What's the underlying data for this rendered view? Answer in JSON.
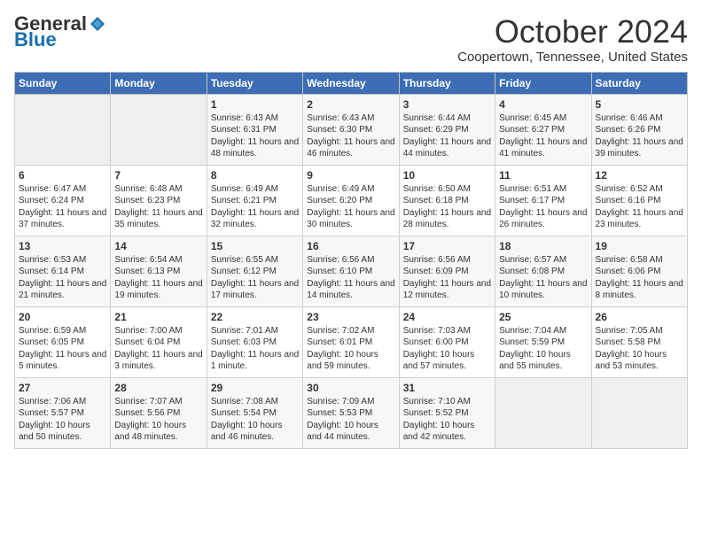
{
  "header": {
    "logo_general": "General",
    "logo_blue": "Blue",
    "month": "October 2024",
    "location": "Coopertown, Tennessee, United States"
  },
  "days_of_week": [
    "Sunday",
    "Monday",
    "Tuesday",
    "Wednesday",
    "Thursday",
    "Friday",
    "Saturday"
  ],
  "weeks": [
    [
      {
        "day": "",
        "content": ""
      },
      {
        "day": "",
        "content": ""
      },
      {
        "day": "1",
        "content": "Sunrise: 6:43 AM\nSunset: 6:31 PM\nDaylight: 11 hours and 48 minutes."
      },
      {
        "day": "2",
        "content": "Sunrise: 6:43 AM\nSunset: 6:30 PM\nDaylight: 11 hours and 46 minutes."
      },
      {
        "day": "3",
        "content": "Sunrise: 6:44 AM\nSunset: 6:29 PM\nDaylight: 11 hours and 44 minutes."
      },
      {
        "day": "4",
        "content": "Sunrise: 6:45 AM\nSunset: 6:27 PM\nDaylight: 11 hours and 41 minutes."
      },
      {
        "day": "5",
        "content": "Sunrise: 6:46 AM\nSunset: 6:26 PM\nDaylight: 11 hours and 39 minutes."
      }
    ],
    [
      {
        "day": "6",
        "content": "Sunrise: 6:47 AM\nSunset: 6:24 PM\nDaylight: 11 hours and 37 minutes."
      },
      {
        "day": "7",
        "content": "Sunrise: 6:48 AM\nSunset: 6:23 PM\nDaylight: 11 hours and 35 minutes."
      },
      {
        "day": "8",
        "content": "Sunrise: 6:49 AM\nSunset: 6:21 PM\nDaylight: 11 hours and 32 minutes."
      },
      {
        "day": "9",
        "content": "Sunrise: 6:49 AM\nSunset: 6:20 PM\nDaylight: 11 hours and 30 minutes."
      },
      {
        "day": "10",
        "content": "Sunrise: 6:50 AM\nSunset: 6:18 PM\nDaylight: 11 hours and 28 minutes."
      },
      {
        "day": "11",
        "content": "Sunrise: 6:51 AM\nSunset: 6:17 PM\nDaylight: 11 hours and 26 minutes."
      },
      {
        "day": "12",
        "content": "Sunrise: 6:52 AM\nSunset: 6:16 PM\nDaylight: 11 hours and 23 minutes."
      }
    ],
    [
      {
        "day": "13",
        "content": "Sunrise: 6:53 AM\nSunset: 6:14 PM\nDaylight: 11 hours and 21 minutes."
      },
      {
        "day": "14",
        "content": "Sunrise: 6:54 AM\nSunset: 6:13 PM\nDaylight: 11 hours and 19 minutes."
      },
      {
        "day": "15",
        "content": "Sunrise: 6:55 AM\nSunset: 6:12 PM\nDaylight: 11 hours and 17 minutes."
      },
      {
        "day": "16",
        "content": "Sunrise: 6:56 AM\nSunset: 6:10 PM\nDaylight: 11 hours and 14 minutes."
      },
      {
        "day": "17",
        "content": "Sunrise: 6:56 AM\nSunset: 6:09 PM\nDaylight: 11 hours and 12 minutes."
      },
      {
        "day": "18",
        "content": "Sunrise: 6:57 AM\nSunset: 6:08 PM\nDaylight: 11 hours and 10 minutes."
      },
      {
        "day": "19",
        "content": "Sunrise: 6:58 AM\nSunset: 6:06 PM\nDaylight: 11 hours and 8 minutes."
      }
    ],
    [
      {
        "day": "20",
        "content": "Sunrise: 6:59 AM\nSunset: 6:05 PM\nDaylight: 11 hours and 5 minutes."
      },
      {
        "day": "21",
        "content": "Sunrise: 7:00 AM\nSunset: 6:04 PM\nDaylight: 11 hours and 3 minutes."
      },
      {
        "day": "22",
        "content": "Sunrise: 7:01 AM\nSunset: 6:03 PM\nDaylight: 11 hours and 1 minute."
      },
      {
        "day": "23",
        "content": "Sunrise: 7:02 AM\nSunset: 6:01 PM\nDaylight: 10 hours and 59 minutes."
      },
      {
        "day": "24",
        "content": "Sunrise: 7:03 AM\nSunset: 6:00 PM\nDaylight: 10 hours and 57 minutes."
      },
      {
        "day": "25",
        "content": "Sunrise: 7:04 AM\nSunset: 5:59 PM\nDaylight: 10 hours and 55 minutes."
      },
      {
        "day": "26",
        "content": "Sunrise: 7:05 AM\nSunset: 5:58 PM\nDaylight: 10 hours and 53 minutes."
      }
    ],
    [
      {
        "day": "27",
        "content": "Sunrise: 7:06 AM\nSunset: 5:57 PM\nDaylight: 10 hours and 50 minutes."
      },
      {
        "day": "28",
        "content": "Sunrise: 7:07 AM\nSunset: 5:56 PM\nDaylight: 10 hours and 48 minutes."
      },
      {
        "day": "29",
        "content": "Sunrise: 7:08 AM\nSunset: 5:54 PM\nDaylight: 10 hours and 46 minutes."
      },
      {
        "day": "30",
        "content": "Sunrise: 7:09 AM\nSunset: 5:53 PM\nDaylight: 10 hours and 44 minutes."
      },
      {
        "day": "31",
        "content": "Sunrise: 7:10 AM\nSunset: 5:52 PM\nDaylight: 10 hours and 42 minutes."
      },
      {
        "day": "",
        "content": ""
      },
      {
        "day": "",
        "content": ""
      }
    ]
  ]
}
